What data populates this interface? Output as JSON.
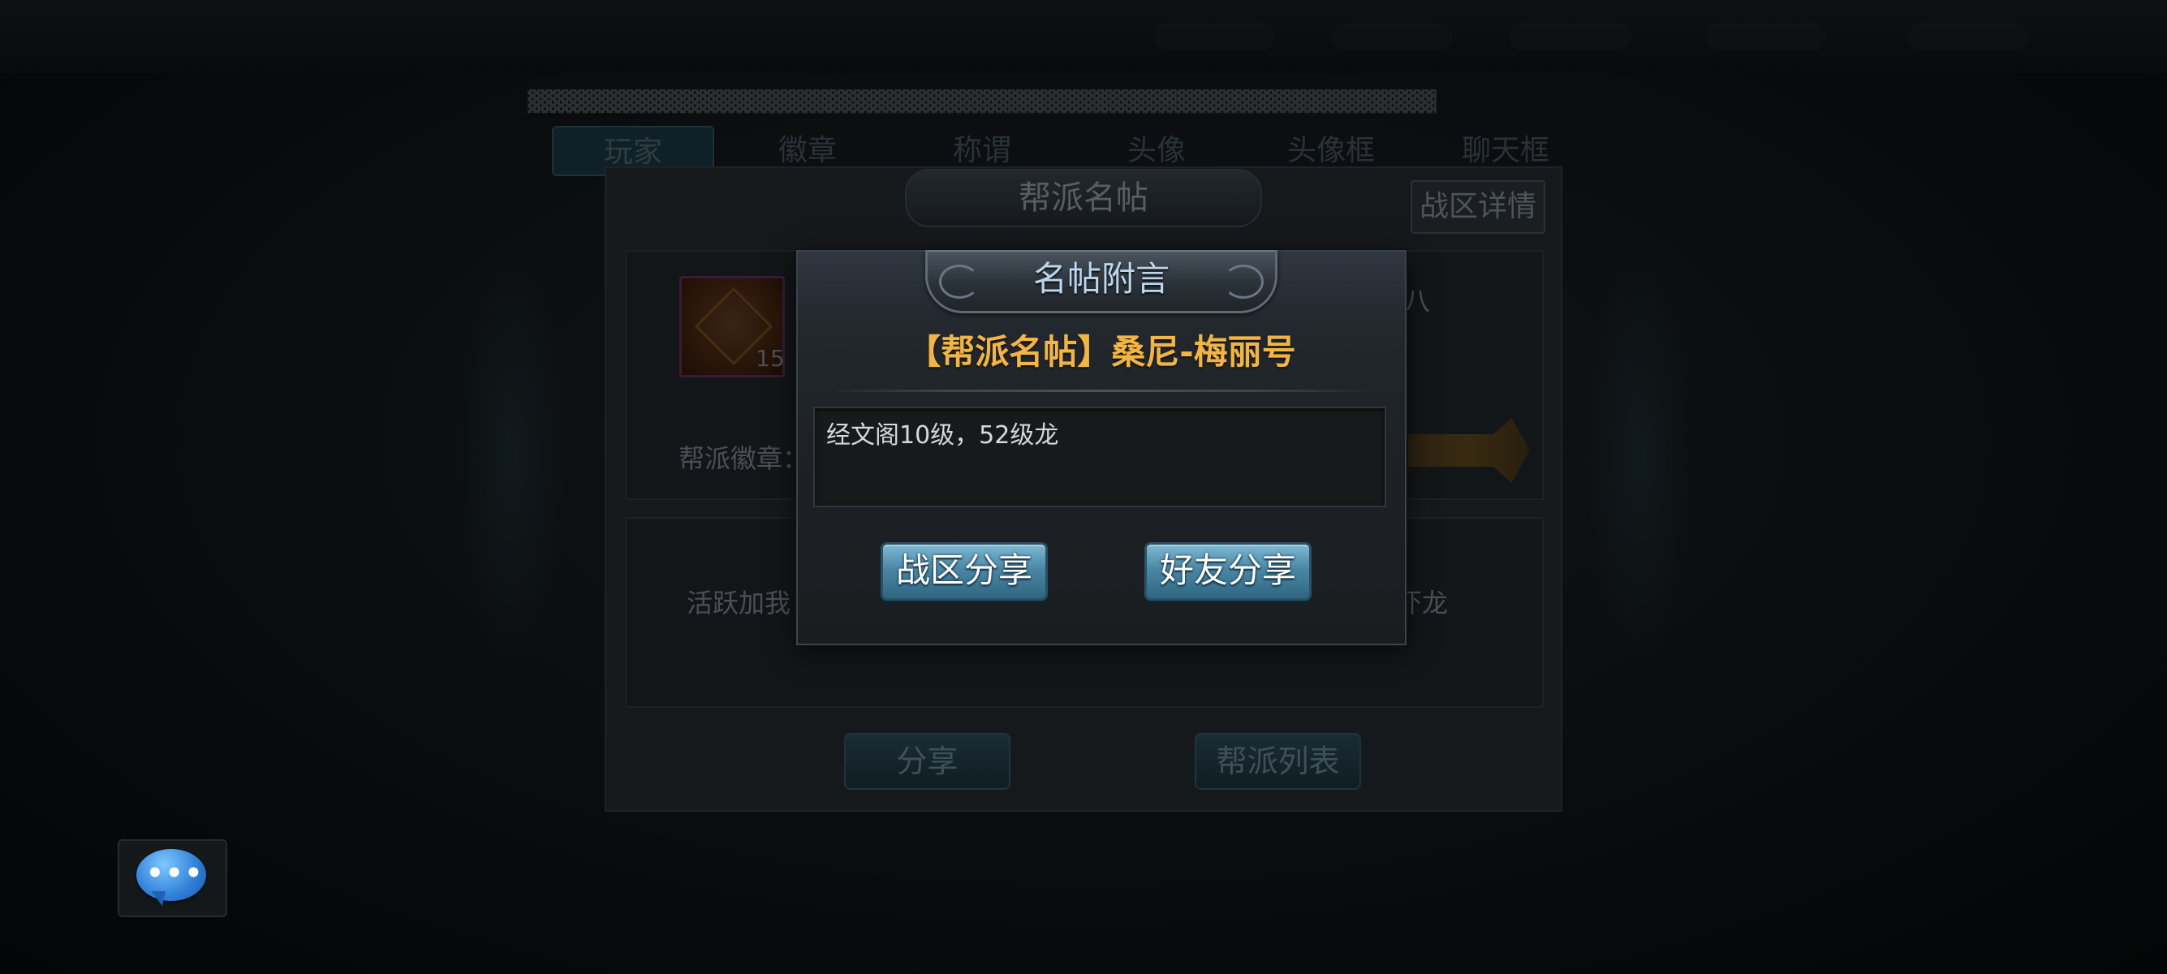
{
  "background": {
    "marquee": "▓▓▓▓▓▓▓▓▓▓▓▓▓▓▓▓▓▓▓▓▓▓▓▓▓▓▓▓▓▓▓▓▓▓▓▓▓▓▓▓▓▓▓▓▓▓▓▓▓▓▓▓▓▓▓▓",
    "tabs": [
      {
        "label": "玩家",
        "active": true
      },
      {
        "label": "徽章",
        "active": false
      },
      {
        "label": "称谓",
        "active": false
      },
      {
        "label": "头像",
        "active": false
      },
      {
        "label": "头像框",
        "active": false
      },
      {
        "label": "聊天框",
        "active": false
      }
    ]
  },
  "guild_card": {
    "title": "帮派名帖",
    "zone_detail_label": "战区详情",
    "avatar_level": "15",
    "right_label_top": "八",
    "emblem_label": "帮派徽章：",
    "notice_left": "活跃加我",
    "notice_right": "吓龙",
    "share_label": "分享",
    "guild_list_label": "帮派列表"
  },
  "modal": {
    "title": "名帖附言",
    "subtitle": "【帮派名帖】桑尼-梅丽号",
    "message": "经文阁10级，52级龙",
    "zone_share_label": "战区分享",
    "friend_share_label": "好友分享"
  },
  "chat": {
    "icon": "chat-bubble-icon",
    "dots": "•••"
  },
  "colors": {
    "subtitle_gold": "#f2b545",
    "modal_title": "#bcd6ee",
    "button_blue": "#4b88a6",
    "chat_blue": "#2e7ed8"
  }
}
